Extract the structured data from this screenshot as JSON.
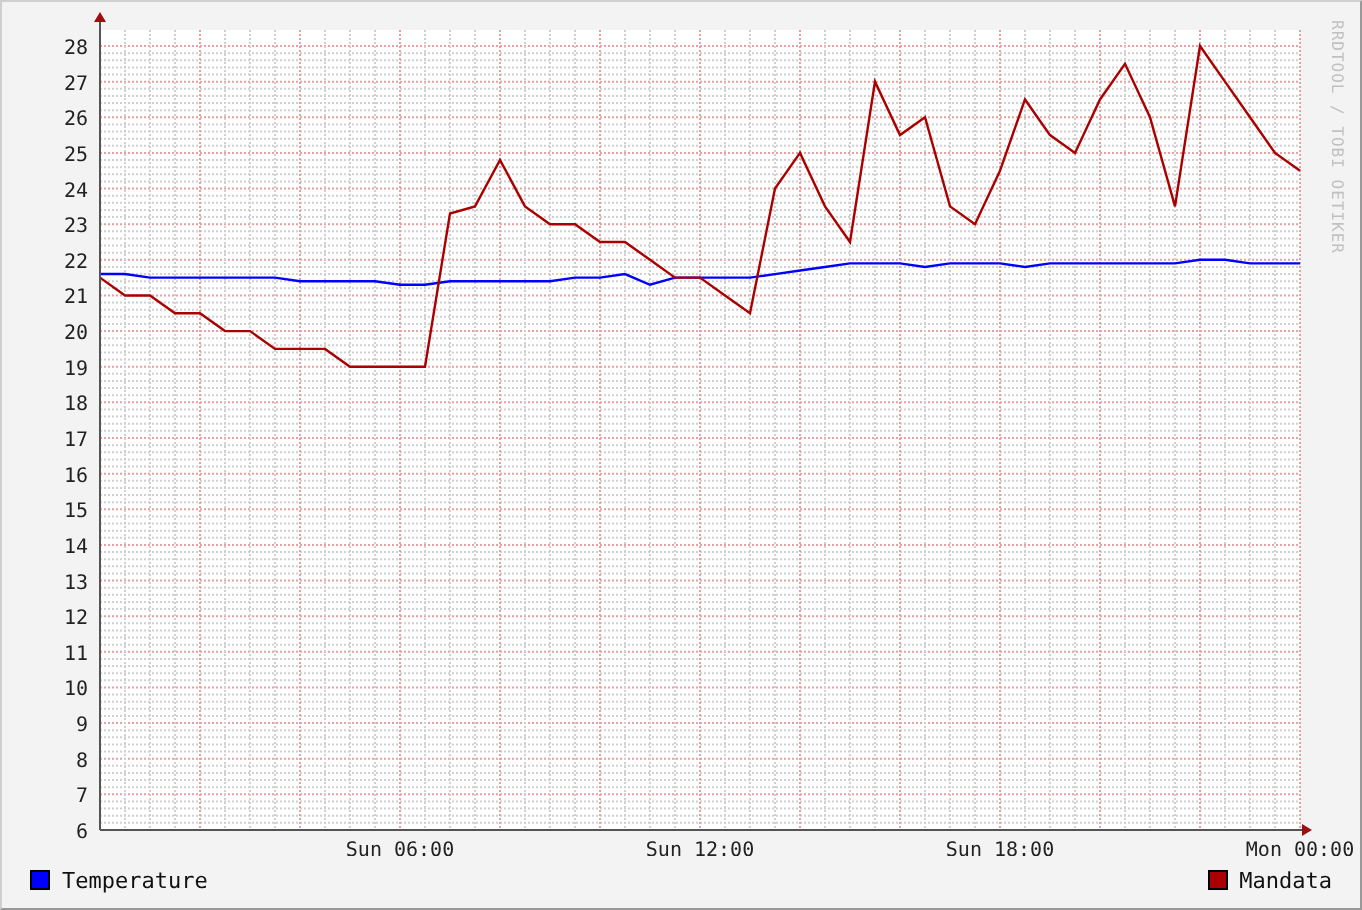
{
  "graph": {
    "credit": "RRDTOOL / TOBI OETIKER",
    "chart_data": {
      "type": "line",
      "grid": true,
      "categories": [
        null,
        null,
        null,
        null,
        null,
        null,
        null,
        null,
        null,
        null,
        null,
        null,
        "Sun 06:00",
        null,
        null,
        null,
        null,
        null,
        null,
        null,
        null,
        null,
        null,
        null,
        "Sun 12:00",
        null,
        null,
        null,
        null,
        null,
        null,
        null,
        null,
        null,
        null,
        null,
        "Sun 18:00",
        null,
        null,
        null,
        null,
        null,
        null,
        null,
        null,
        null,
        null,
        null,
        "Mon 00:00"
      ],
      "series": [
        {
          "name": "Temperature",
          "color": "#0000ff",
          "values": [
            21.6,
            21.6,
            21.5,
            21.5,
            21.5,
            21.5,
            21.5,
            21.5,
            21.4,
            21.4,
            21.4,
            21.4,
            21.3,
            21.3,
            21.4,
            21.4,
            21.4,
            21.4,
            21.4,
            21.5,
            21.5,
            21.6,
            21.3,
            21.5,
            21.5,
            21.5,
            21.5,
            21.6,
            21.7,
            21.8,
            21.9,
            21.9,
            21.9,
            21.8,
            21.9,
            21.9,
            21.9,
            21.8,
            21.9,
            21.9,
            21.9,
            21.9,
            21.9,
            21.9,
            22.0,
            22.0,
            21.9,
            21.9,
            21.9
          ]
        },
        {
          "name": "Mandata",
          "color": "#aa0000",
          "values": [
            21.5,
            21,
            21,
            20.5,
            20.5,
            20,
            20,
            19.5,
            19.5,
            19.5,
            19,
            19,
            19,
            19,
            23.3,
            23.5,
            24.8,
            23.5,
            23,
            23,
            22.5,
            22.5,
            22,
            21.5,
            21.5,
            21,
            20.5,
            24,
            25,
            23.5,
            22.5,
            27,
            25.5,
            26,
            23.5,
            23,
            24.5,
            26.5,
            25.5,
            25,
            26.5,
            27.5,
            26,
            23.5,
            28,
            27,
            26,
            25,
            24.5
          ]
        }
      ],
      "ylim": [
        6,
        28
      ],
      "yticks": [
        6,
        7,
        8,
        9,
        10,
        11,
        12,
        13,
        14,
        15,
        16,
        17,
        18,
        19,
        20,
        21,
        22,
        23,
        24,
        25,
        26,
        27,
        28
      ]
    }
  }
}
